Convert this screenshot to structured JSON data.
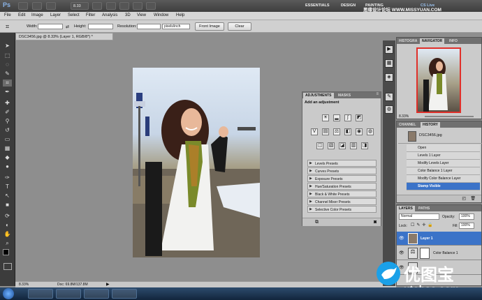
{
  "app": {
    "logo": "Ps",
    "zoom": "8.33",
    "workspace": [
      "ESSENTIALS",
      "DESIGN",
      "PAINTING"
    ],
    "cslive": "CS Live",
    "watermark_top": "思缘设计论坛 WWW.MISSYUAN.COM"
  },
  "menu": [
    "File",
    "Edit",
    "Image",
    "Layer",
    "Select",
    "Filter",
    "Analysis",
    "3D",
    "View",
    "Window",
    "Help"
  ],
  "options": {
    "width_label": "Width:",
    "height_label": "Height:",
    "resolution_label": "Resolution:",
    "resolution_unit": "pixels/inch",
    "front_image": "Front Image",
    "clear": "Clear"
  },
  "document": {
    "tab_title": "DSC3456.jpg @ 8.33% (Layer 1, RGB/8*) *",
    "zoom_status": "8.33%",
    "doc_status": "Doc: 69.8M/137.8M"
  },
  "adjustments": {
    "tabs": [
      "ADJUSTMENTS",
      "MASKS"
    ],
    "heading": "Add an adjustment",
    "presets": [
      "Levels Presets",
      "Curves Presets",
      "Exposure Presets",
      "Hue/Saturation Presets",
      "Black & White Presets",
      "Channel Mixer Presets",
      "Selective Color Presets"
    ]
  },
  "navigator": {
    "tabs": [
      "HISTOGRA",
      "NAVIGATOR",
      "INFO"
    ],
    "zoom": "8.33%"
  },
  "history": {
    "tabs": [
      "CHANNEL",
      "HISTORY"
    ],
    "snapshot": "DSC3456.jpg",
    "items": [
      "Open",
      "Levels 1 Layer",
      "Modify Levels Layer",
      "Color Balance 1 Layer",
      "Modify Color Balance Layer",
      "Stamp Visible"
    ]
  },
  "layers": {
    "tabs": [
      "LAYERS",
      "PATHS"
    ],
    "blend_mode": "Normal",
    "opacity_label": "Opacity:",
    "opacity": "100%",
    "lock_label": "Lock:",
    "fill_label": "Fill:",
    "fill": "100%",
    "rows": [
      "Layer 1",
      "Color Balance 1"
    ]
  },
  "branding": {
    "watermark": "优图宝",
    "watermark_url": "utobao.com"
  },
  "colors": {
    "accent": "#3a7fe0",
    "highlight": "#3b73c8"
  }
}
